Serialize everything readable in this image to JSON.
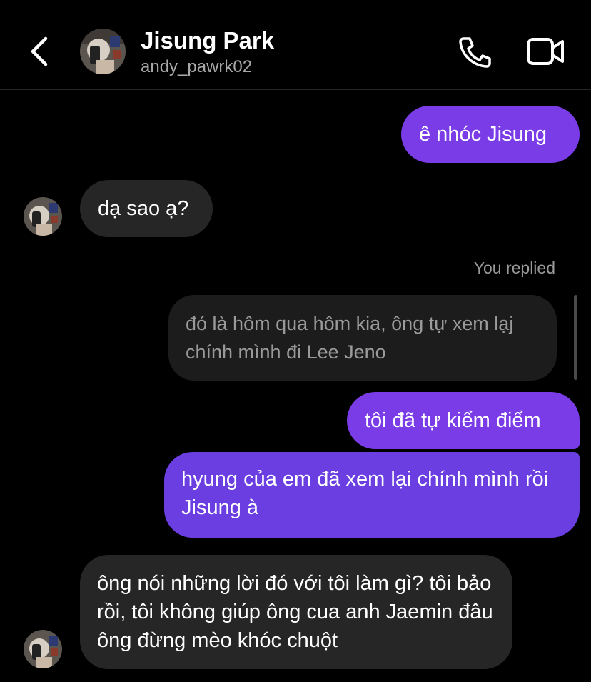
{
  "header": {
    "name": "Jisung Park",
    "username": "andy_pawrk02",
    "back_icon": "chevron-left-icon",
    "call_icon": "phone-icon",
    "video_icon": "video-camera-icon"
  },
  "messages": [
    {
      "sender": "me",
      "text": "ê nhóc Jisung"
    },
    {
      "sender": "them",
      "text": "dạ sao ạ?"
    },
    {
      "reply_label": "You replied",
      "quoted_text": "đó là hôm qua hôm kia, ông tự xem lạj chính mình đi Lee Jeno"
    },
    {
      "sender": "me",
      "text": "tôi đã tự kiểm điểm"
    },
    {
      "sender": "me",
      "text": "hyung của em đã xem lại chính mình rồi Jisung à"
    },
    {
      "sender": "them",
      "text": "ông nói những lời đó với tôi làm gì? tôi bảo rồi, tôi không giúp ông cua anh Jaemin đâu ông đừng mèo khóc chuột"
    }
  ],
  "colors": {
    "background": "#000000",
    "sent_bubble": "#7a3ce6",
    "received_bubble": "#262626",
    "secondary_text": "#a8a8a8"
  }
}
